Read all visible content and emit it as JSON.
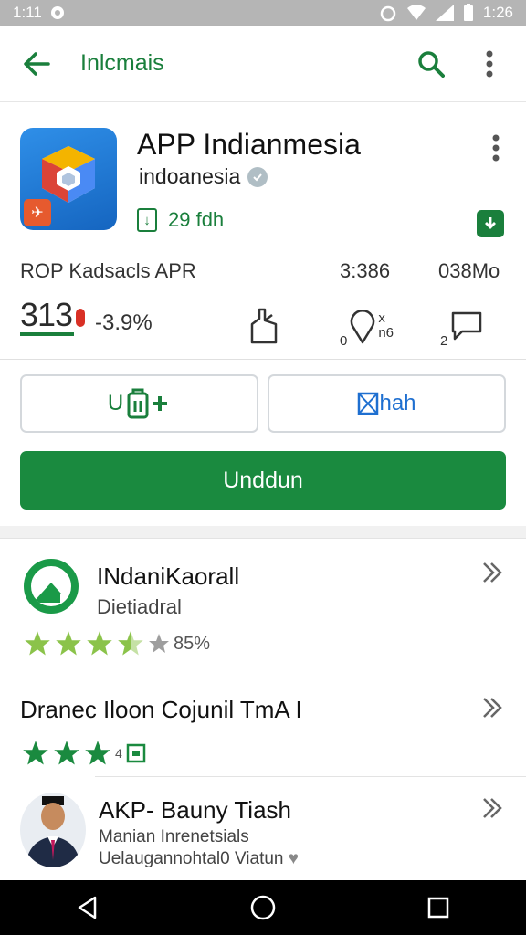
{
  "status_bar": {
    "time": "1:11",
    "right_time": "1:26"
  },
  "app_bar": {
    "title": "Inlcmais"
  },
  "app": {
    "name": "APP Indianmesia",
    "developer": "indoanesia",
    "size_label": "29 fdh",
    "meta_left": "ROP Kadsacls APR",
    "meta_mid": "3:386",
    "meta_right": "038Mo",
    "rating_big": "313",
    "rating_pct": "-3.9%",
    "stat2_label_top": "x",
    "stat2_label_bottom": "0",
    "stat2_side": "n6",
    "stat3_label": "2"
  },
  "actions": {
    "install_outline_label": "U",
    "share_label": "hah",
    "primary_label": "Unddun"
  },
  "related": [
    {
      "title": "INdaniKaorall",
      "subtitle": "Dietiadral",
      "rating_text": "85%",
      "stars_full": 3,
      "stars_half": 1
    },
    {
      "title": "Dranec Iloon Cojunil TmA I",
      "rating_text": "4",
      "stars_full": 3
    },
    {
      "title": "AKP- Bauny Tiash",
      "subtitle": "Manian Inrenetsials",
      "subtitle2": "Uelaugannohtal0 Viatun"
    }
  ],
  "colors": {
    "accent_green": "#1a8a3f",
    "blue": "#1e6fd0",
    "status_bar": "#b5b5b5"
  }
}
